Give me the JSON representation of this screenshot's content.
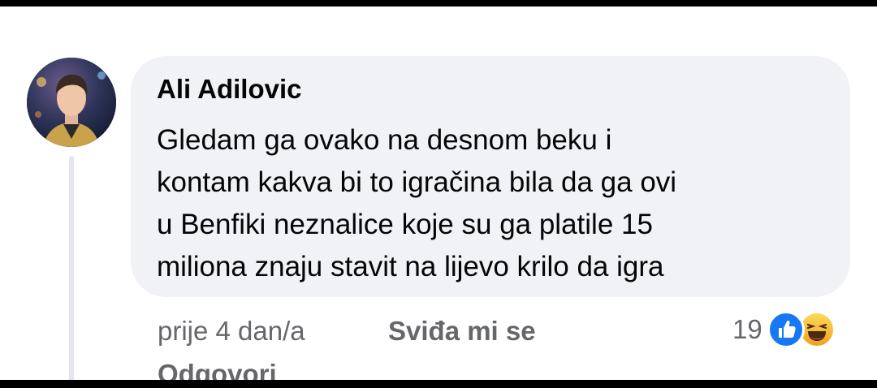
{
  "comment": {
    "author": "Ali Adilovic",
    "text_lines": [
      "Gledam ga ovako na desnom beku i",
      "kontam kakva bi to igračina bila da ga ovi",
      "u Benfiki neznalice koje su ga platile 15",
      "miliona znaju stavit na lijevo krilo da igra"
    ],
    "timestamp": "prije 4 dan/a",
    "like_label": "Sviđa mi se",
    "reply_label": "Odgovori",
    "reaction_count": "19",
    "reaction_icons": [
      "like-icon",
      "haha-icon"
    ]
  },
  "colors": {
    "bubble": "#f0f2f5",
    "text": "#050505",
    "secondary_text": "#65676b",
    "like_blue": "#1877f2",
    "haha_yellow": "#f7b125",
    "thread_line": "#e4e6eb"
  }
}
